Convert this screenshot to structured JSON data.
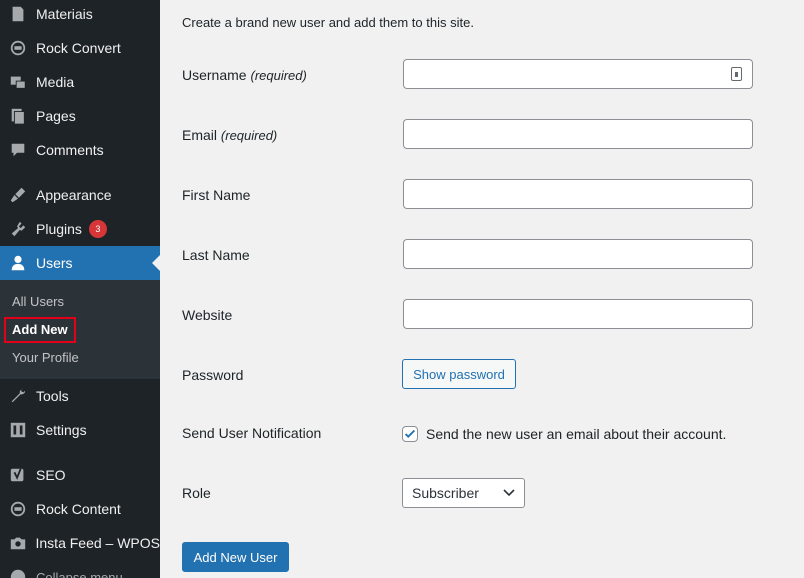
{
  "sidebar": {
    "items": [
      {
        "label": "Materiais",
        "icon": "materiais-icon"
      },
      {
        "label": "Rock Convert",
        "icon": "rock-convert-icon"
      },
      {
        "label": "Media",
        "icon": "media-icon"
      },
      {
        "label": "Pages",
        "icon": "pages-icon"
      },
      {
        "label": "Comments",
        "icon": "comments-icon"
      },
      {
        "label": "Appearance",
        "icon": "appearance-icon"
      },
      {
        "label": "Plugins",
        "icon": "plugins-icon",
        "badge": "3"
      },
      {
        "label": "Users",
        "icon": "users-icon",
        "active": true
      },
      {
        "label": "Tools",
        "icon": "tools-icon"
      },
      {
        "label": "Settings",
        "icon": "settings-icon"
      },
      {
        "label": "SEO",
        "icon": "seo-icon"
      },
      {
        "label": "Rock Content",
        "icon": "rock-content-icon"
      },
      {
        "label": "Insta Feed – WPOS",
        "icon": "camera-icon"
      },
      {
        "label": "Collapse menu",
        "icon": "collapse-icon"
      }
    ],
    "submenu": [
      {
        "label": "All Users"
      },
      {
        "label": "Add New",
        "current": true
      },
      {
        "label": "Your Profile"
      }
    ]
  },
  "main": {
    "intro": "Create a brand new user and add them to this site.",
    "username_label": "Username",
    "username_req": "(required)",
    "email_label": "Email",
    "email_req": "(required)",
    "first_name_label": "First Name",
    "last_name_label": "Last Name",
    "website_label": "Website",
    "password_label": "Password",
    "show_password_label": "Show password",
    "notification_label": "Send User Notification",
    "notification_text": "Send the new user an email about their account.",
    "notification_checked": true,
    "role_label": "Role",
    "role_value": "Subscriber",
    "submit_label": "Add New User"
  },
  "colors": {
    "sidebar_bg": "#1d2327",
    "accent": "#2271b1",
    "badge": "#d63638",
    "highlight": "#e2001a"
  }
}
